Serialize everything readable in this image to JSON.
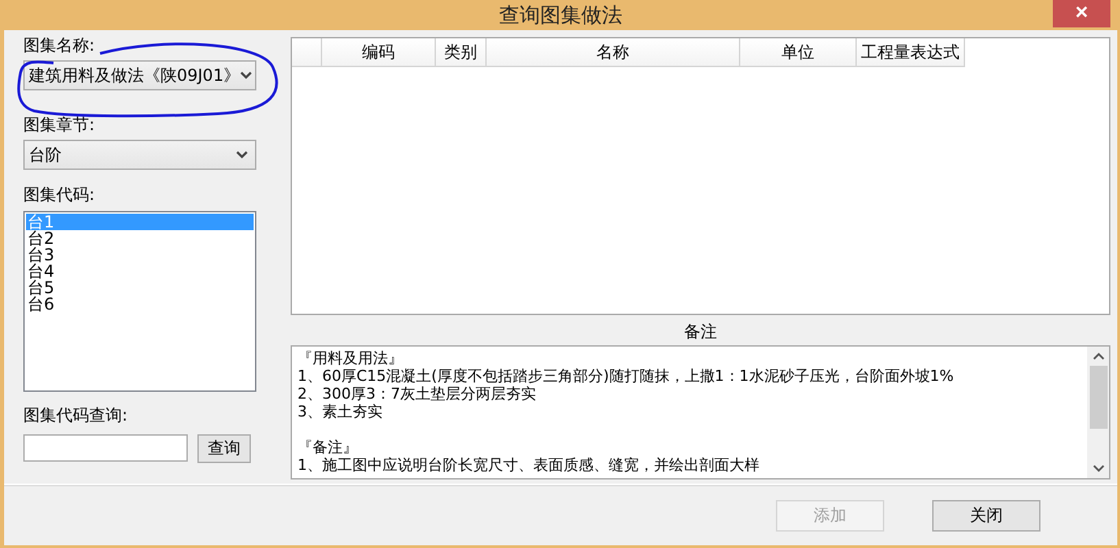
{
  "window": {
    "title": "查询图集做法",
    "close": "×"
  },
  "left": {
    "atlas_name_label": "图集名称:",
    "atlas_name_value": "建筑用料及做法《陕09J01》",
    "chapter_label": "图集章节:",
    "chapter_value": "台阶",
    "code_label": "图集代码:",
    "codes": [
      {
        "label": "台1",
        "selected": true
      },
      {
        "label": "台2",
        "selected": false
      },
      {
        "label": "台3",
        "selected": false
      },
      {
        "label": "台4",
        "selected": false
      },
      {
        "label": "台5",
        "selected": false
      },
      {
        "label": "台6",
        "selected": false
      }
    ],
    "query_label": "图集代码查询:",
    "query_button": "查询"
  },
  "table": {
    "columns": [
      "编码",
      "类别",
      "名称",
      "单位",
      "工程量表达式"
    ]
  },
  "notes": {
    "label": "备注",
    "blocks": [
      {
        "heading": "『用料及用法』",
        "lines": [
          "1、60厚C15混凝土(厚度不包括踏步三角部分)随打随抹，上撒1：1水泥砂子压光，台阶面外坡1%",
          "2、300厚3：7灰土垫层分两层夯实",
          "3、素土夯实"
        ]
      },
      {
        "heading": "『备注』",
        "lines": [
          "1、施工图中应说明台阶长宽尺寸、表面质感、缝宽，并绘出剖面大样"
        ]
      }
    ]
  },
  "buttons": [
    {
      "label": "添加",
      "disabled": true
    },
    {
      "label": "关闭",
      "disabled": false
    }
  ]
}
